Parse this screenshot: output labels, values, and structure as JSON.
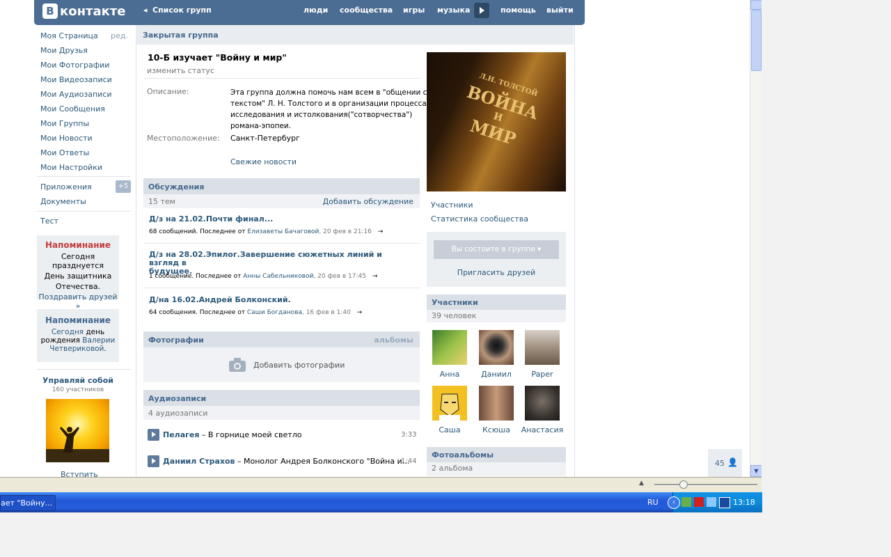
{
  "header": {
    "logo": "контакте",
    "logo_letter": "В",
    "back": "Список групп",
    "nav": [
      "люди",
      "сообщества",
      "игры",
      "музыка",
      "помощь",
      "выйти"
    ]
  },
  "sidebar": {
    "items": [
      "Моя Страница",
      "Мои Друзья",
      "Мои Фотографии",
      "Мои Видеозаписи",
      "Мои Аудиозаписи",
      "Мои Сообщения",
      "Мои Группы",
      "Мои Новости",
      "Мои Ответы",
      "Мои Настройки"
    ],
    "edit": "ред.",
    "apps": "Приложения",
    "apps_badge": "+5",
    "docs": "Документы",
    "test": "Тест",
    "reminder1": {
      "title": "Напоминание",
      "line1": "Сегодня празднуется",
      "line2": "День защитника",
      "line3": "Отечества.",
      "link": "Поздравить друзей »"
    },
    "reminder2": {
      "title": "Напоминание",
      "line1": "Сегодня",
      "line1b": "день",
      "line2": "рождения",
      "line2b": "Валерии",
      "line3": "Четвериковой",
      "line3b": "."
    },
    "promo": {
      "title": "Управляй собой",
      "members": "160 участников",
      "join": "Вступить"
    }
  },
  "group": {
    "type": "Закрытая группа",
    "name": "10-Б изучает \"Войну и мир\"",
    "change_status": "изменить статус",
    "desc_label": "Описание:",
    "desc_lines": [
      "Эта группа должна помочь нам всем в \"общении с",
      "текстом\" Л. Н. Толстого и в организации процесса",
      "исследования и истолкования(\"сотворчества\")",
      "романа-эпопеи."
    ],
    "loc_label": "Местоположение:",
    "location": "Санкт-Петербург",
    "news": "Свежие новости"
  },
  "discussions": {
    "title": "Обсуждения",
    "count": "15 тем",
    "add": "Добавить обсуждение",
    "topics": [
      {
        "title": "Д/з на 21.02.Почти финал...",
        "meta": "68 сообщений. Последнее от ",
        "author": "Елизаветы Бачаговой",
        "date": ", 20 фев в 21:16"
      },
      {
        "title1": "Д/з на 28.02.Эпилог.Завершение сюжетных линий и взгляд в",
        "title2": "будущее.",
        "meta": "1 сообщение. Последнее от ",
        "author": "Анны Сабельниковой",
        "date": ", 20 фев в 17:45"
      },
      {
        "title": "Д/на 16.02.Андрей Болконский.",
        "meta": "64 сообщения. Последнее от ",
        "author": "Саши Богданова",
        "date": ", 16 фев в 1:40"
      }
    ]
  },
  "photos": {
    "title": "Фотографии",
    "albums": "альбомы",
    "add": "Добавить фотографии"
  },
  "audio": {
    "title": "Аудиозаписи",
    "count": "4 аудиозаписи",
    "tracks": [
      {
        "artist": "Пелагея",
        "title": " – В горнице моей светло",
        "time": "3:33"
      },
      {
        "artist": "Даниил Страхов",
        "title": " – Монолог Андрея Болконского \"Война и...",
        "time": "1:44"
      }
    ]
  },
  "right": {
    "links": [
      "Участники",
      "Статистика сообщества"
    ],
    "member_btn": "Вы состоите в группе",
    "invite": "Пригласить друзей",
    "members_title": "Участники",
    "members_count": "39 человек",
    "members": [
      "Анна",
      "Даниил",
      "Paper",
      "Саша",
      "Ксюша",
      "Анастасия"
    ],
    "albums_title": "Фотоальбомы",
    "albums_count": "2 альбома",
    "book_text": [
      "Л.Н. ТОЛСТОЙ",
      "ВОЙНА",
      "И",
      "МИР"
    ]
  },
  "online_count": "45",
  "taskbar": {
    "task": "ает \"Войну...",
    "lang": "RU",
    "time": "13:18"
  }
}
